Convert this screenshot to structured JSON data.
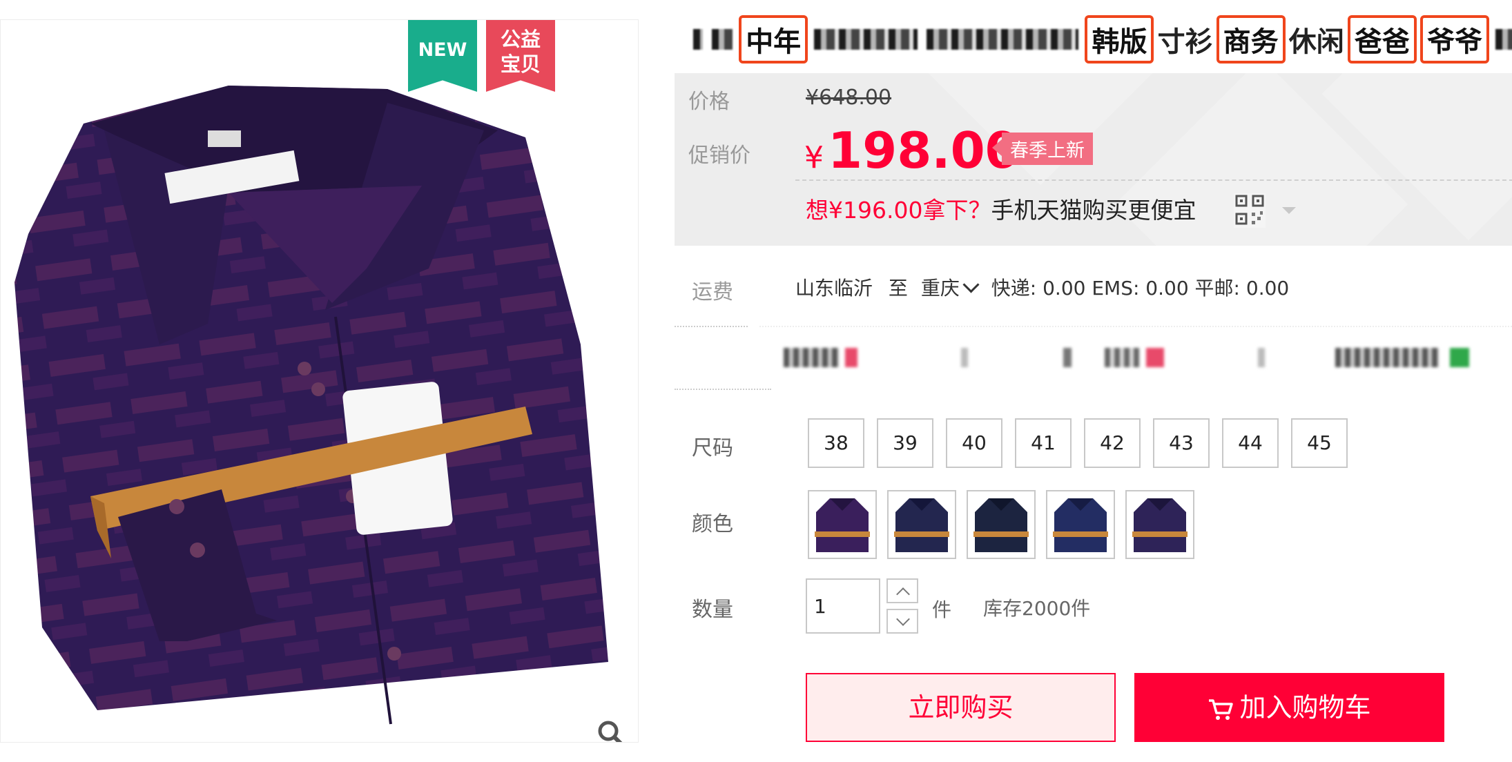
{
  "badges": {
    "new": "NEW",
    "charity_line1": "公益",
    "charity_line2": "宝贝"
  },
  "title": {
    "pieces": [
      "中年",
      "韩版",
      "寸衫",
      "商务",
      "休闲",
      "爸爸",
      "爷爷"
    ]
  },
  "price": {
    "original_label": "价格",
    "original_value": "¥648.00",
    "promo_label": "促销价",
    "promo_currency": "¥",
    "promo_value": "198.00",
    "promo_tag": "春季上新",
    "app_deal_red": "想¥196.00拿下？",
    "app_deal_dark": "手机天猫购买更便宜"
  },
  "shipping": {
    "label": "运费",
    "origin": "山东临沂",
    "to": "至",
    "destination": "重庆",
    "rates": "快递: 0.00 EMS: 0.00 平邮: 0.00"
  },
  "sku": {
    "size_label": "尺码",
    "sizes": [
      "38",
      "39",
      "40",
      "41",
      "42",
      "43",
      "44",
      "45"
    ],
    "color_label": "颜色",
    "color_count": 5
  },
  "quantity": {
    "label": "数量",
    "value": "1",
    "unit": "件",
    "stock": "库存2000件"
  },
  "actions": {
    "buy_now": "立即购买",
    "add_cart": "加入购物车"
  },
  "icons": {
    "zoom": "search-icon",
    "qr": "qr-code-icon",
    "cart": "cart-icon"
  },
  "colors": {
    "accent": "#ff0036",
    "new_badge": "#19ad8c",
    "charity_badge": "#e8495a",
    "highlight_box": "#f0451c",
    "shirt": "#3a1f5c"
  }
}
